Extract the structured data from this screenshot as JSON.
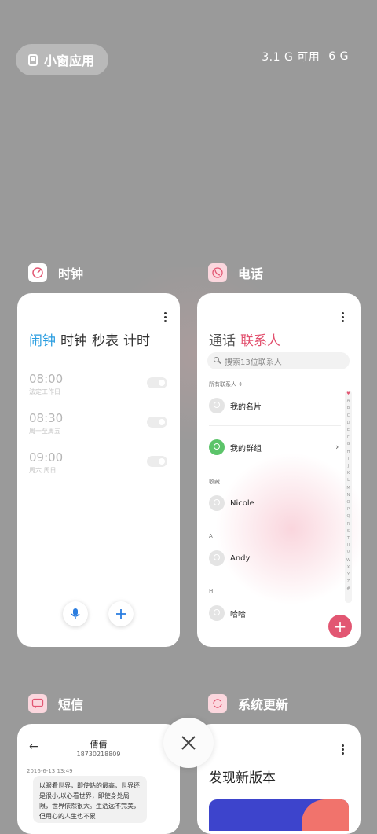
{
  "top": {
    "small_window_label": "小窗应用",
    "memory_available": "3.1 G 可用",
    "memory_total": "6 G"
  },
  "apps": {
    "clock": {
      "name": "时钟",
      "tabs": [
        "闹钟",
        "时钟",
        "秒表",
        "计时"
      ],
      "alarms": [
        {
          "time": "08:00",
          "label": "法定工作日"
        },
        {
          "time": "08:30",
          "label": "周一至周五"
        },
        {
          "time": "09:00",
          "label": "周六 周日"
        }
      ]
    },
    "phone": {
      "name": "电话",
      "tabs": [
        "通话",
        "联系人"
      ],
      "search_placeholder": "搜索13位联系人",
      "all_contacts": "所有联系人",
      "my_card": "我的名片",
      "my_groups": "我的群组",
      "favorites_header": "收藏",
      "section_a": "A",
      "section_h": "H",
      "contacts": [
        "Nicole",
        "Andy",
        "哈哈"
      ],
      "az": [
        "♥",
        "A",
        "B",
        "C",
        "D",
        "E",
        "F",
        "G",
        "H",
        "I",
        "J",
        "K",
        "L",
        "M",
        "N",
        "O",
        "P",
        "Q",
        "R",
        "S",
        "T",
        "U",
        "V",
        "W",
        "X",
        "Y",
        "Z",
        "#"
      ]
    },
    "sms": {
      "name": "短信",
      "contact_name": "倩倩",
      "contact_number": "18730218809",
      "timestamp": "2016-6-13 13:49",
      "message": "以眼看世界，即使站的最高，世界还是很小;以心看世界，即使身处局限，世界依然很大。生活远不完美，但用心的人生也不累"
    },
    "update": {
      "name": "系统更新",
      "title": "发现新版本"
    }
  },
  "colors": {
    "accent_clock": "#2a9de0",
    "accent_phone": "#e2506e",
    "background": "#9a9a9a"
  }
}
